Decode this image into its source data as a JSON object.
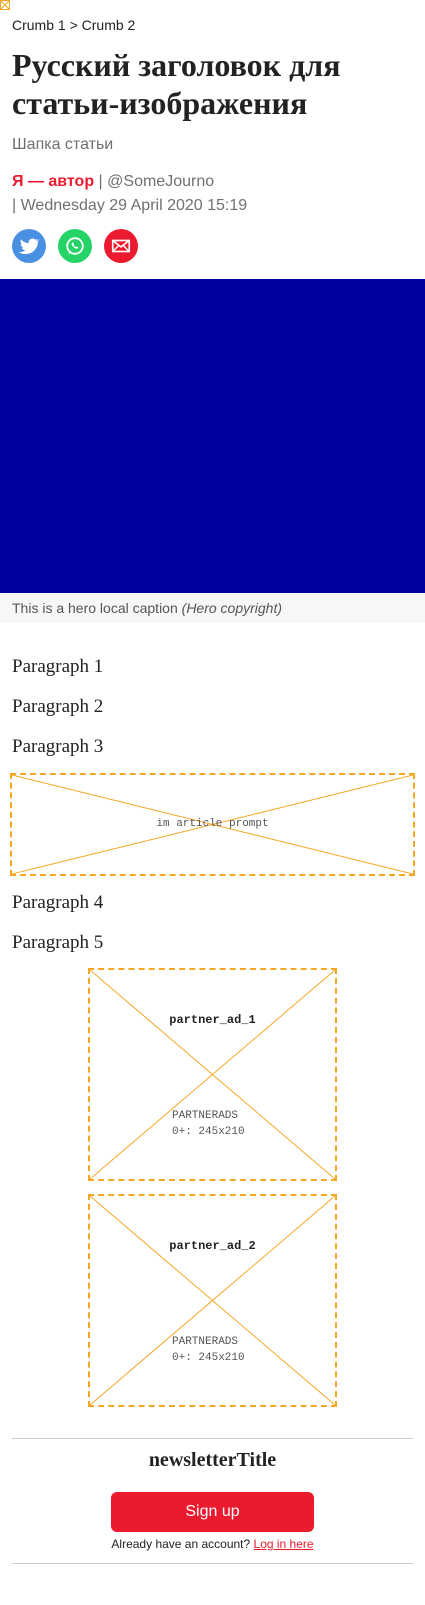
{
  "breadcrumb": {
    "crumb1": "Crumb 1",
    "separator": ">",
    "crumb2": "Crumb 2"
  },
  "article": {
    "title": "Русский заголовок для статьи-изображения",
    "standfirst": "Шапка статьи",
    "author": "Я — автор",
    "twitter_handle": "@SomeJourno",
    "date": "Wednesday 29 April 2020 15:19",
    "byline_separator": "|",
    "caption_text": "This is a hero local caption",
    "caption_copyright": "(Hero copyright)",
    "hero_color": "#00009e",
    "paragraphs": [
      "Paragraph 1",
      "Paragraph 2",
      "Paragraph 3",
      "Paragraph 4",
      "Paragraph 5"
    ]
  },
  "share": {
    "icons": [
      "twitter-icon",
      "whatsapp-icon",
      "email-icon"
    ],
    "colors": {
      "twitter": "#4a90e2",
      "whatsapp": "#25d366",
      "email": "#ec1a2e"
    }
  },
  "ads": {
    "prompt_label": "im article prompt",
    "partner_ad_1": {
      "name": "partner_ad_1",
      "line1": "PARTNERADS",
      "line2": "0+: 245x210"
    },
    "partner_ad_2": {
      "name": "partner_ad_2",
      "line1": "PARTNERADS",
      "line2": "0+: 245x210"
    },
    "border_color": "#f5a623"
  },
  "newsletter": {
    "title": "newsletterTitle",
    "signup_label": "Sign up",
    "login_prompt": "Already have an account?",
    "login_link": "Log in here"
  },
  "colors": {
    "accent": "#ec1a2e",
    "muted_text": "#707070"
  }
}
